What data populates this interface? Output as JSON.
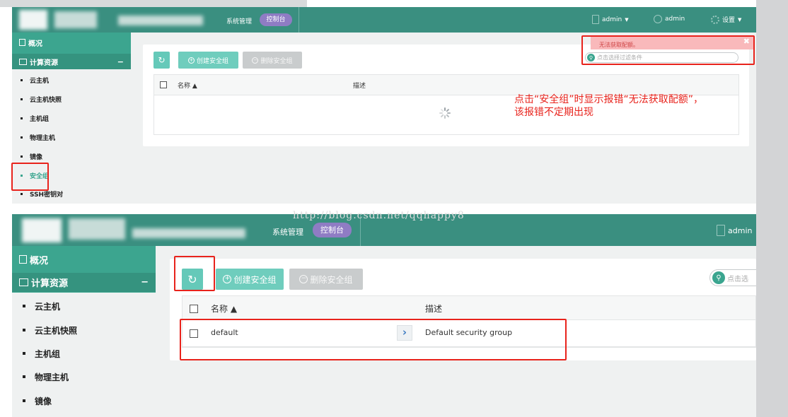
{
  "colors": {
    "navbar": "#3a8f80",
    "sidebar": "#3ca58f",
    "accent_purple": "#8f7cc4",
    "annotation_red": "#e8231c",
    "toast_bg": "#f9b9bb"
  },
  "top_panel": {
    "navbar": {
      "system_label": "系统管理",
      "console_label": "控制台",
      "user_menu": "admin",
      "user_name": "admin",
      "settings_label": "设置",
      "icons": [
        "document-icon",
        "user-icon",
        "gear-icon"
      ]
    },
    "sidebar": {
      "overview": "概况",
      "compute": "计算资源",
      "compute_toggle": "−",
      "items": [
        "云主机",
        "云主机快照",
        "主机组",
        "物理主机",
        "镜像",
        "安全组",
        "SSH密钥对"
      ],
      "active_item": "安全组"
    },
    "toolbar": {
      "create_label": "创建安全组",
      "delete_label": "删除安全组"
    },
    "search": {
      "placeholder": "点击选择过滤条件"
    },
    "table": {
      "col_name": "名称 ▲",
      "col_desc": "描述"
    },
    "toast": {
      "message": "无法获取配额。",
      "close": "✖"
    }
  },
  "annotation": {
    "line1": "点击“安全组”时显示报错“无法获取配额”，",
    "line2": "该报错不定期出现"
  },
  "watermark": "http://blog.csdn.net/qqhappy8",
  "bottom_panel": {
    "navbar": {
      "system_label": "系统管理",
      "console_label": "控制台",
      "user_menu": "admin"
    },
    "sidebar": {
      "overview": "概况",
      "compute": "计算资源",
      "compute_toggle": "−",
      "items": [
        "云主机",
        "云主机快照",
        "主机组",
        "物理主机",
        "镜像"
      ]
    },
    "toolbar": {
      "create_label": "创建安全组",
      "delete_label": "删除安全组"
    },
    "search": {
      "placeholder": "点击选"
    },
    "table": {
      "col_name": "名称 ▲",
      "col_desc": "描述",
      "rows": [
        {
          "name": "default",
          "description": "Default security group"
        }
      ]
    }
  }
}
